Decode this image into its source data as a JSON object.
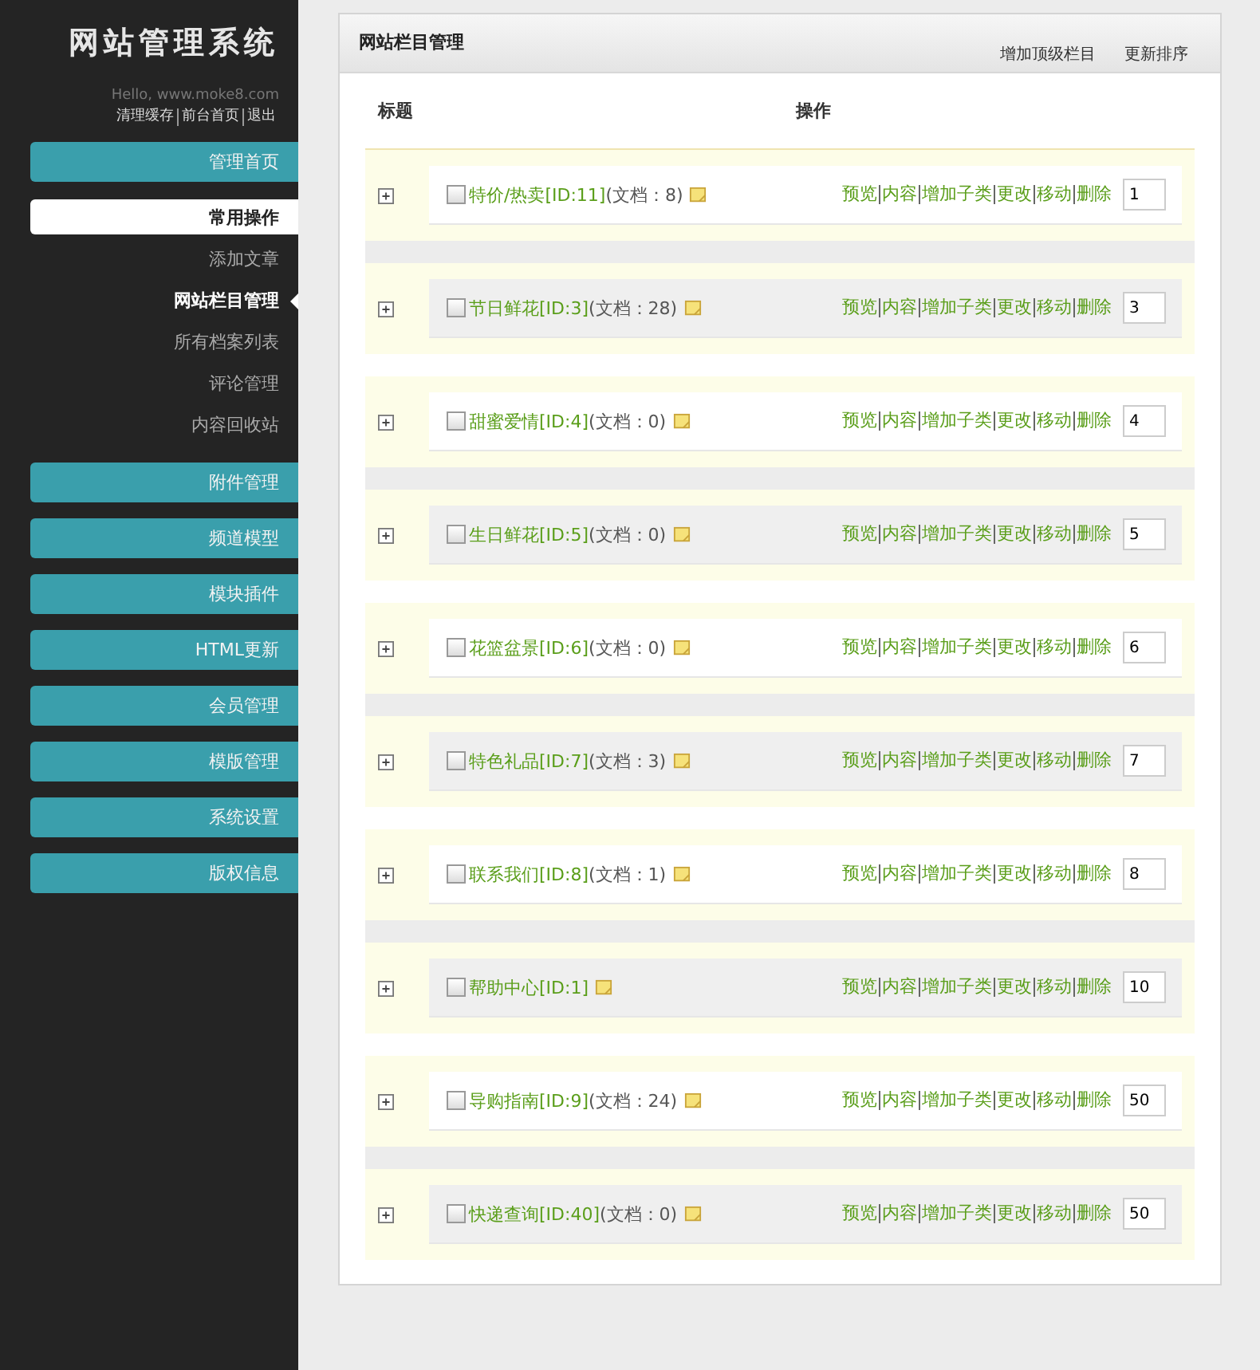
{
  "sidebar": {
    "logo": "网站管理系统",
    "greeting": "Hello, www.moke8.com",
    "quick_links": [
      "清理缓存",
      "前台首页",
      "退出"
    ],
    "menu": [
      {
        "label": "管理首页",
        "kind": "group"
      },
      {
        "label": "常用操作",
        "kind": "group",
        "expanded": true,
        "children": [
          {
            "label": "添加文章",
            "selected": false
          },
          {
            "label": "网站栏目管理",
            "selected": true
          },
          {
            "label": "所有档案列表",
            "selected": false
          },
          {
            "label": "评论管理",
            "selected": false
          },
          {
            "label": "内容回收站",
            "selected": false
          }
        ]
      },
      {
        "label": "附件管理",
        "kind": "group"
      },
      {
        "label": "频道模型",
        "kind": "group"
      },
      {
        "label": "模块插件",
        "kind": "group"
      },
      {
        "label": "HTML更新",
        "kind": "group"
      },
      {
        "label": "会员管理",
        "kind": "group"
      },
      {
        "label": "模版管理",
        "kind": "group"
      },
      {
        "label": "系统设置",
        "kind": "group"
      },
      {
        "label": "版权信息",
        "kind": "group"
      }
    ]
  },
  "panel": {
    "title": "网站栏目管理",
    "actions": [
      "增加顶级栏目",
      "更新排序"
    ],
    "table": {
      "columns": [
        "标题",
        "操作"
      ],
      "rows": [
        {
          "name": "特价/热卖[ID:11]",
          "count": "(文档：8)",
          "checked": false,
          "actions": [
            "预览",
            "内容",
            "增加子类",
            "更改",
            "移动",
            "删除"
          ],
          "order": "1"
        },
        {
          "name": "节日鲜花[ID:3]",
          "count": "(文档：28)",
          "checked": false,
          "actions": [
            "预览",
            "内容",
            "增加子类",
            "更改",
            "移动",
            "删除"
          ],
          "order": "3"
        },
        {
          "name": "甜蜜爱情[ID:4]",
          "count": "(文档：0)",
          "checked": false,
          "actions": [
            "预览",
            "内容",
            "增加子类",
            "更改",
            "移动",
            "删除"
          ],
          "order": "4"
        },
        {
          "name": "生日鲜花[ID:5]",
          "count": "(文档：0)",
          "checked": false,
          "actions": [
            "预览",
            "内容",
            "增加子类",
            "更改",
            "移动",
            "删除"
          ],
          "order": "5"
        },
        {
          "name": "花篮盆景[ID:6]",
          "count": "(文档：0)",
          "checked": false,
          "actions": [
            "预览",
            "内容",
            "增加子类",
            "更改",
            "移动",
            "删除"
          ],
          "order": "6"
        },
        {
          "name": "特色礼品[ID:7]",
          "count": "(文档：3)",
          "checked": false,
          "actions": [
            "预览",
            "内容",
            "增加子类",
            "更改",
            "移动",
            "删除"
          ],
          "order": "7"
        },
        {
          "name": "联系我们[ID:8]",
          "count": "(文档：1)",
          "checked": false,
          "actions": [
            "预览",
            "内容",
            "增加子类",
            "更改",
            "移动",
            "删除"
          ],
          "order": "8"
        },
        {
          "name": "帮助中心[ID:1]",
          "checked": false,
          "actions": [
            "预览",
            "内容",
            "增加子类",
            "更改",
            "移动",
            "删除"
          ],
          "order": "10"
        },
        {
          "name": "导购指南[ID:9]",
          "count": "(文档：24)",
          "checked": false,
          "actions": [
            "预览",
            "内容",
            "增加子类",
            "更改",
            "移动",
            "删除"
          ],
          "order": "50"
        },
        {
          "name": "快递查询[ID:40]",
          "count": "(文档：0)",
          "checked": false,
          "actions": [
            "预览",
            "内容",
            "增加子类",
            "更改",
            "移动",
            "删除"
          ],
          "order": "50"
        }
      ]
    }
  }
}
